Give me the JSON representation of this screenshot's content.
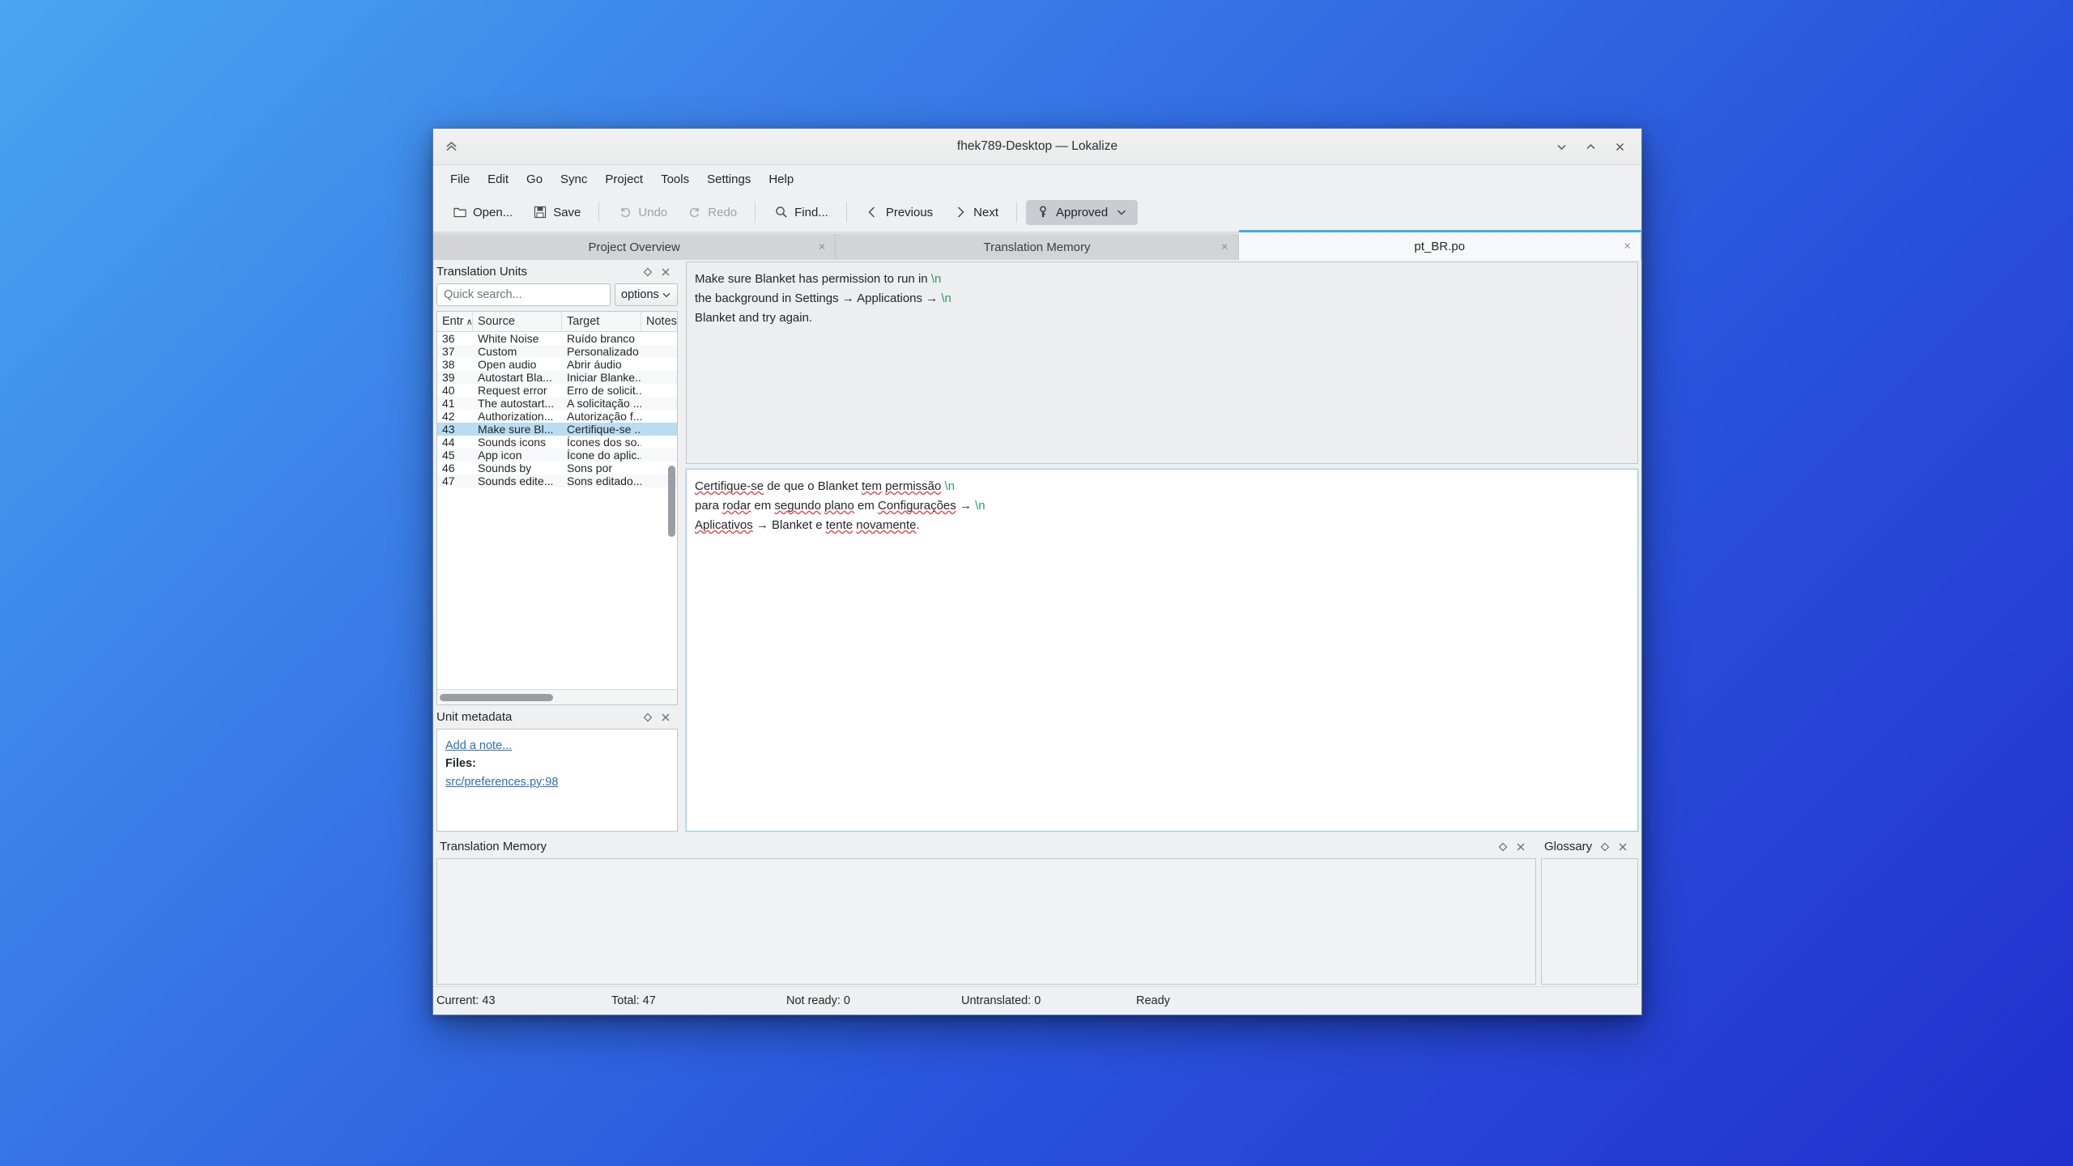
{
  "window": {
    "title": "fhek789-Desktop — Lokalize",
    "controls": {
      "minimize": "minimize",
      "maximize": "maximize",
      "close": "close"
    },
    "home_icon": "collapse-chevrons-icon"
  },
  "menubar": {
    "items": [
      "File",
      "Edit",
      "Go",
      "Sync",
      "Project",
      "Tools",
      "Settings",
      "Help"
    ]
  },
  "toolbar": {
    "open_label": "Open...",
    "save_label": "Save",
    "undo_label": "Undo",
    "redo_label": "Redo",
    "find_label": "Find...",
    "previous_label": "Previous",
    "next_label": "Next",
    "approved_label": "Approved"
  },
  "tabs": [
    {
      "label": "Project Overview",
      "close": "×",
      "active": false
    },
    {
      "label": "Translation Memory",
      "close": "×",
      "active": false
    },
    {
      "label": "pt_BR.po",
      "close": "×",
      "active": true
    }
  ],
  "translation_units": {
    "title": "Translation Units",
    "search_placeholder": "Quick search...",
    "search_value": "",
    "options_label": "options",
    "columns": [
      "Entr",
      "Source",
      "Target",
      "Notes"
    ],
    "sort_indicator": "∧",
    "rows": [
      {
        "entry": "36",
        "source": "White Noise",
        "target": "Ruído branco",
        "notes": ""
      },
      {
        "entry": "37",
        "source": "Custom",
        "target": "Personalizado",
        "notes": ""
      },
      {
        "entry": "38",
        "source": "Open audio",
        "target": "Abrir áudio",
        "notes": ""
      },
      {
        "entry": "39",
        "source": "Autostart Bla...",
        "target": "Iniciar Blanke...",
        "notes": ""
      },
      {
        "entry": "40",
        "source": "Request error",
        "target": "Erro de solicit...",
        "notes": ""
      },
      {
        "entry": "41",
        "source": "The autostart...",
        "target": "A solicitação ...",
        "notes": ""
      },
      {
        "entry": "42",
        "source": "Authorization...",
        "target": "Autorização f...",
        "notes": ""
      },
      {
        "entry": "43",
        "source": "Make sure Bl...",
        "target": "Certifique-se ...",
        "notes": ""
      },
      {
        "entry": "44",
        "source": "Sounds icons",
        "target": "Ícones dos so...",
        "notes": ""
      },
      {
        "entry": "45",
        "source": "App icon",
        "target": "Ícone do aplic...",
        "notes": ""
      },
      {
        "entry": "46",
        "source": "Sounds by",
        "target": "Sons por",
        "notes": ""
      },
      {
        "entry": "47",
        "source": "Sounds edite...",
        "target": "Sons editado...",
        "notes": ""
      }
    ],
    "selected_entry": "43"
  },
  "unit_metadata": {
    "title": "Unit metadata",
    "add_note_label": "Add a note...",
    "files_label": "Files:",
    "file_ref": "src/preferences.py:98"
  },
  "source_pane": {
    "line1_a": "Make sure Blanket has permission to run in ",
    "line1_esc": "\\n",
    "line2_a": "the background in Settings → Applications → ",
    "line2_esc": "\\n",
    "line3_a": "Blanket and try again."
  },
  "target_pane": {
    "l1_w1": "Certifique-se",
    "l1_w2": " de que o Blanket ",
    "l1_w3": "tem",
    "l1_w4": " ",
    "l1_w5": "permissão",
    "l1_esc": "\\n",
    "l2_w1": "para ",
    "l2_w2": "rodar",
    "l2_w3": " em ",
    "l2_w4": "segundo",
    "l2_w5": " ",
    "l2_w6": "plano",
    "l2_w7": " em ",
    "l2_w8": "Configurações",
    "l2_w9": " → ",
    "l2_esc": "\\n",
    "l3_w1": "Aplicativos",
    "l3_w2": " → Blanket e ",
    "l3_w3": "tente",
    "l3_w4": " ",
    "l3_w5": "novamente",
    "l3_w6": "."
  },
  "bottom_docks": {
    "translation_memory_title": "Translation Memory",
    "glossary_title": "Glossary"
  },
  "statusbar": {
    "current": "Current: 43",
    "total": "Total: 47",
    "not_ready": "Not ready: 0",
    "untranslated": "Untranslated: 0",
    "state": "Ready"
  },
  "colors": {
    "accent": "#3daee9",
    "selection": "#b8dcf2",
    "escape_seq": "#2e9b57",
    "spellcheck": "#e05252",
    "link": "#2b6ebf"
  }
}
